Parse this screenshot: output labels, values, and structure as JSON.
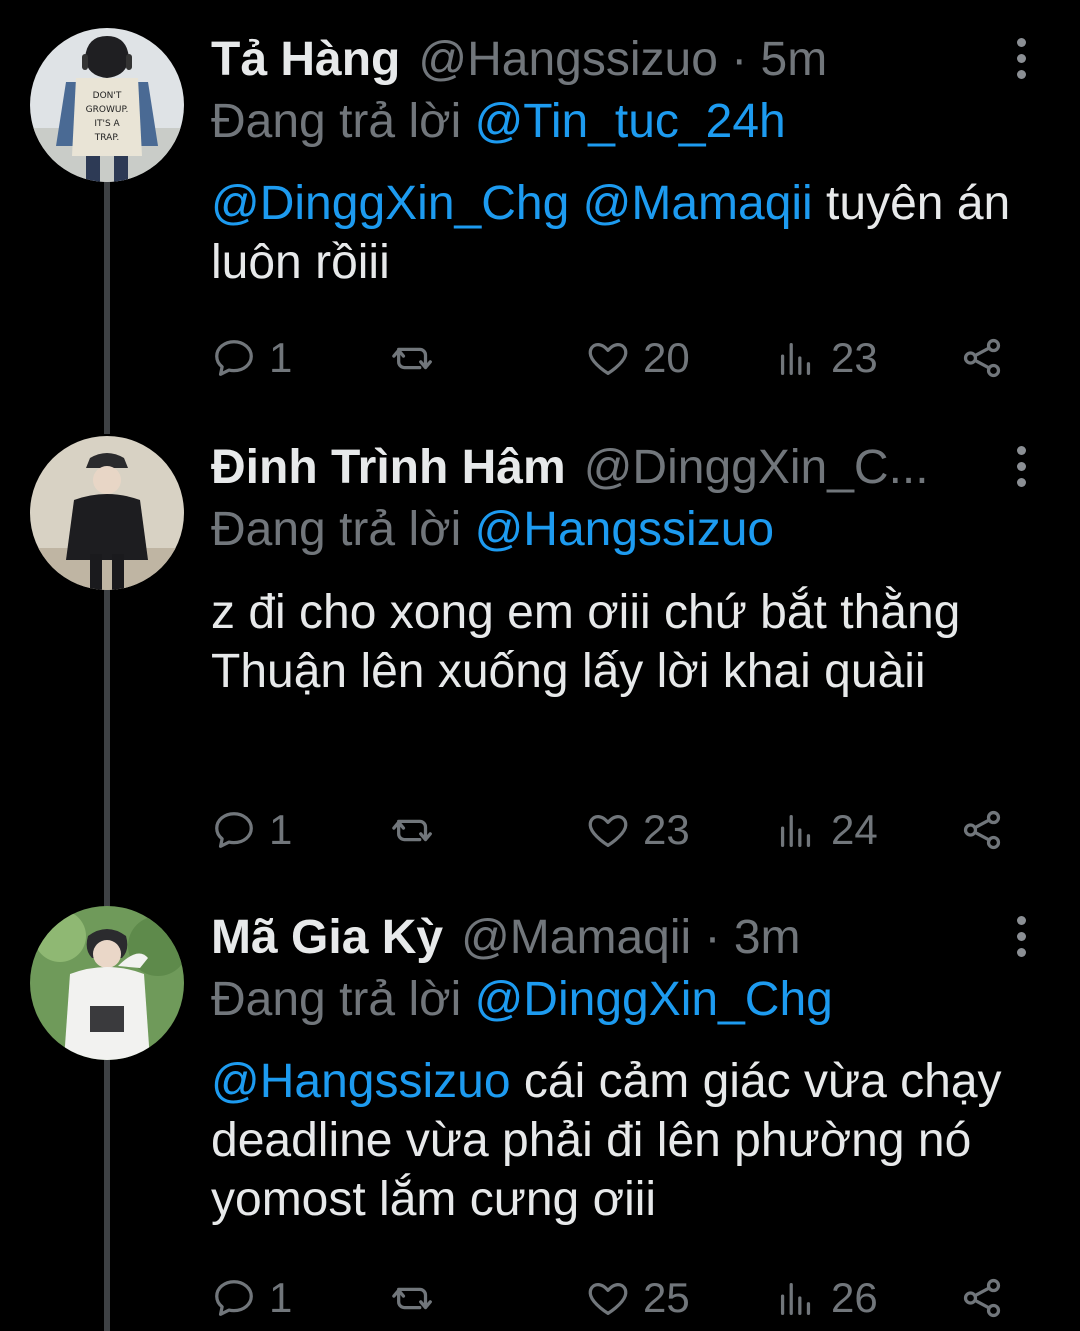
{
  "tweets": [
    {
      "name": "Tả Hàng",
      "handle": "@Hangssizuo",
      "time": "5m",
      "meta": "@Hangssizuo · 5m",
      "replying_prefix": "Đang trả lời ",
      "replying_to": "@Tin_tuc_24h",
      "body_mentions": "@DinggXin_Chg @Mamaqii",
      "body_text": " tuyên án luôn rồiii",
      "replies": "1",
      "retweets": "",
      "likes": "20",
      "views": "23",
      "avatar_text": [
        "DON'T",
        "GROWUP.",
        "IT'S A",
        "TRAP."
      ]
    },
    {
      "name": "Đinh Trình Hâm",
      "handle": "@DinggXin_C...",
      "time": "",
      "meta": "@DinggXin_C...",
      "replying_prefix": "Đang trả lời ",
      "replying_to": "@Hangssizuo",
      "body_mentions": "",
      "body_text": "z đi cho xong em ơiii chứ bắt thằng Thuận lên xuống lấy lời khai quàii",
      "replies": "1",
      "retweets": "",
      "likes": "23",
      "views": "24"
    },
    {
      "name": "Mã Gia Kỳ",
      "handle": "@Mamaqii",
      "time": "3m",
      "meta": "@Mamaqii · 3m",
      "replying_prefix": "Đang trả lời ",
      "replying_to": "@DinggXin_Chg",
      "body_mentions": "@Hangssizuo",
      "body_text": " cái cảm giác vừa chạy deadline vừa phải đi lên phường nó yomost lắm cưng ơiii",
      "replies": "1",
      "retweets": "",
      "likes": "25",
      "views": "26"
    }
  ],
  "icons": {
    "reply": "reply-icon",
    "retweet": "retweet-icon",
    "like": "heart-icon",
    "views": "views-icon",
    "share": "share-icon",
    "more": "more-icon"
  },
  "colors": {
    "background": "#000000",
    "text": "#e7e9ea",
    "muted": "#71767b",
    "link": "#1d9bf0",
    "thread_line": "#3e4144"
  }
}
